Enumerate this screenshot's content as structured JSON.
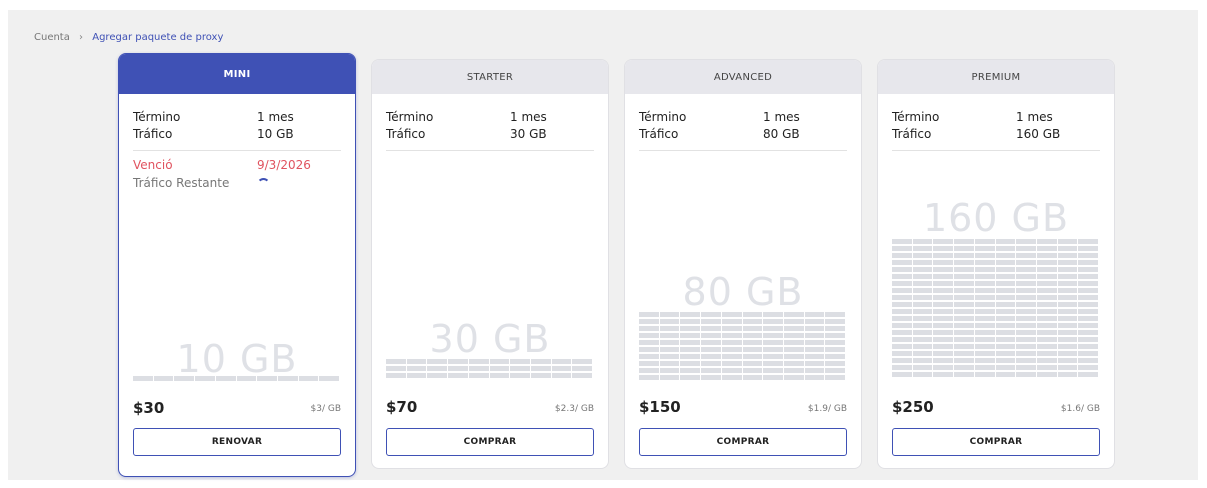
{
  "breadcrumb": {
    "root": "Cuenta",
    "current": "Agregar paquete de proxy"
  },
  "plans": [
    {
      "name": "MINI",
      "selected": true,
      "term_label": "Término",
      "term_value": "1 mes",
      "traffic_label": "Tráfico",
      "traffic_value": "10 GB",
      "expired_label": "Venció",
      "expired_value": "9/3/2026",
      "remaining_label": "Tráfico Restante",
      "gb_display": "10 GB",
      "bar_rows": 1,
      "price": "$30",
      "per_gb": "$3/ GB",
      "button": "RENOVAR"
    },
    {
      "name": "STARTER",
      "selected": false,
      "term_label": "Término",
      "term_value": "1 mes",
      "traffic_label": "Tráfico",
      "traffic_value": "30 GB",
      "gb_display": "30 GB",
      "bar_rows": 3,
      "price": "$70",
      "per_gb": "$2.3/ GB",
      "button": "COMPRAR"
    },
    {
      "name": "ADVANCED",
      "selected": false,
      "term_label": "Término",
      "term_value": "1 mes",
      "traffic_label": "Tráfico",
      "traffic_value": "80 GB",
      "gb_display": "80 GB",
      "bar_rows": 10,
      "price": "$150",
      "per_gb": "$1.9/ GB",
      "button": "COMPRAR"
    },
    {
      "name": "PREMIUM",
      "selected": false,
      "term_label": "Término",
      "term_value": "1 mes",
      "traffic_label": "Tráfico",
      "traffic_value": "160 GB",
      "gb_display": "160 GB",
      "bar_rows": 20,
      "price": "$250",
      "per_gb": "$1.6/ GB",
      "button": "COMPRAR"
    }
  ],
  "colors": {
    "accent": "#3f51b5",
    "expired": "#e0535f"
  }
}
